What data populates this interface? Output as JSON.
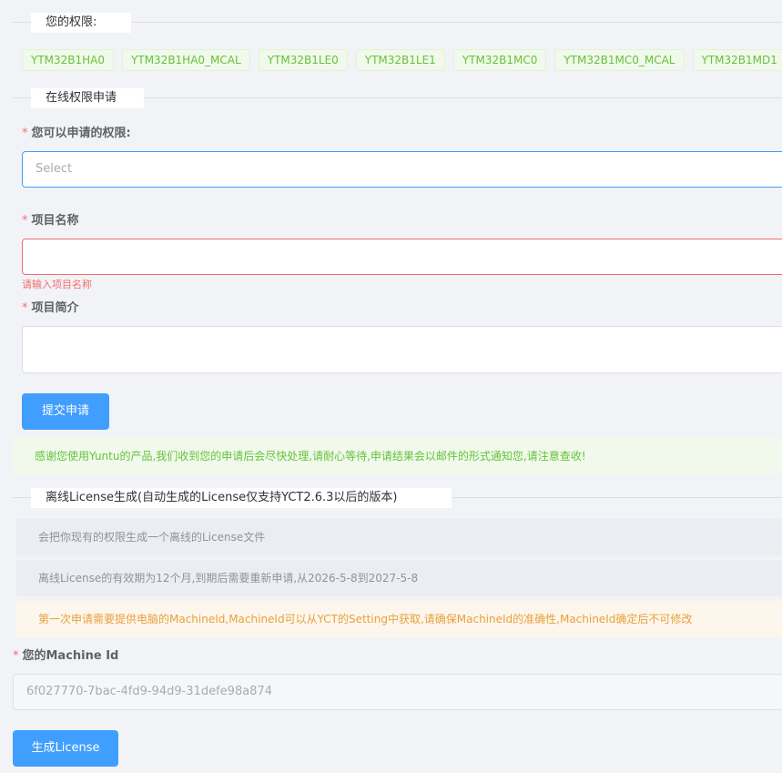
{
  "permissions": {
    "title": "您的权限:",
    "tags": [
      "YTM32B1HA0",
      "YTM32B1HA0_MCAL",
      "YTM32B1LE0",
      "YTM32B1LE1",
      "YTM32B1MC0",
      "YTM32B1MC0_MCAL",
      "YTM32B1MD1",
      ""
    ]
  },
  "online_apply": {
    "title": "在线权限申请",
    "permission_label": "您可以申请的权限:",
    "permission_placeholder": "Select",
    "project_name_label": "项目名称",
    "project_name_value": "",
    "project_name_error": "请输入项目名称",
    "project_desc_label": "项目简介",
    "project_desc_value": "",
    "submit_label": "提交申请",
    "success_message": "感谢您使用Yuntu的产品,我们收到您的申请后会尽快处理,请耐心等待,申请结果会以邮件的形式通知您,请注意查收!"
  },
  "offline_license": {
    "title": "离线License生成(自动生成的License仅支持YCT2.6.3以后的版本)",
    "info_1": "会把你现有的权限生成一个离线的License文件",
    "info_2": "离线License的有效期为12个月,到期后需要重新申请,从2026-5-8到2027-5-8",
    "warning": "第一次申请需要提供电脑的MachineId,MachineId可以从YCT的Setting中获取,请确保MachineId的准确性,MachineId确定后不可修改",
    "machine_id_label": "您的Machine Id",
    "machine_id_value": "6f027770-7bac-4fd9-94d9-31defe98a874",
    "generate_label": "生成License"
  },
  "colors": {
    "primary": "#409eff",
    "success": "#67c23a",
    "warning": "#e6a23c",
    "danger": "#f56c6c"
  }
}
